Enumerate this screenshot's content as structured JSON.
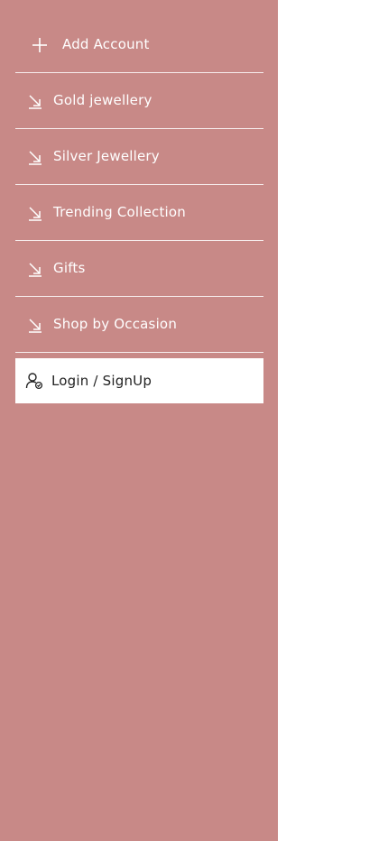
{
  "colors": {
    "drawer_bg": "#c88987",
    "text_on_drawer": "#ffffff",
    "login_bg": "#ffffff",
    "login_text": "#222222"
  },
  "menu": {
    "add_account": {
      "label": "Add Account",
      "icon": "plus-icon"
    },
    "items": [
      {
        "label": "Gold jewellery",
        "icon": "arrow-down-right-icon"
      },
      {
        "label": "Silver Jewellery",
        "icon": "arrow-down-right-icon"
      },
      {
        "label": "Trending Collection",
        "icon": "arrow-down-right-icon"
      },
      {
        "label": "Gifts",
        "icon": "arrow-down-right-icon"
      },
      {
        "label": "Shop by Occasion",
        "icon": "arrow-down-right-icon"
      }
    ]
  },
  "login": {
    "label": "Login / SignUp",
    "icon": "user-check-icon"
  }
}
